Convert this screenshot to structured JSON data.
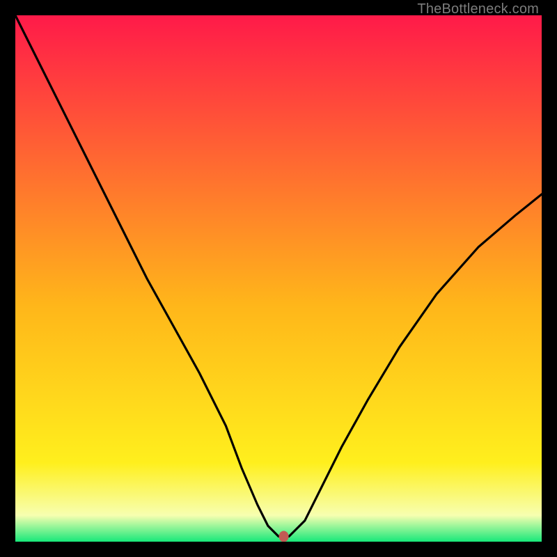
{
  "watermark": "TheBottleneck.com",
  "colors": {
    "top": "#ff1a49",
    "mid": "#ffef1d",
    "bottom": "#17e87a",
    "frame": "#000000",
    "curve": "#000000",
    "marker": "#c25a54"
  },
  "chart_data": {
    "type": "line",
    "title": "",
    "xlabel": "",
    "ylabel": "",
    "xlim": [
      0,
      100
    ],
    "ylim": [
      0,
      100
    ],
    "grid": false,
    "legend": false,
    "series": [
      {
        "name": "bottleneck-curve",
        "x": [
          0,
          5,
          10,
          15,
          20,
          25,
          30,
          35,
          40,
          43,
          46,
          48,
          50,
          52,
          55,
          58,
          62,
          67,
          73,
          80,
          88,
          95,
          100
        ],
        "values": [
          100,
          90,
          80,
          70,
          60,
          50,
          41,
          32,
          22,
          14,
          7,
          3,
          1,
          1,
          4,
          10,
          18,
          27,
          37,
          47,
          56,
          62,
          66
        ]
      }
    ],
    "marker": {
      "x": 51,
      "y": 1
    }
  }
}
